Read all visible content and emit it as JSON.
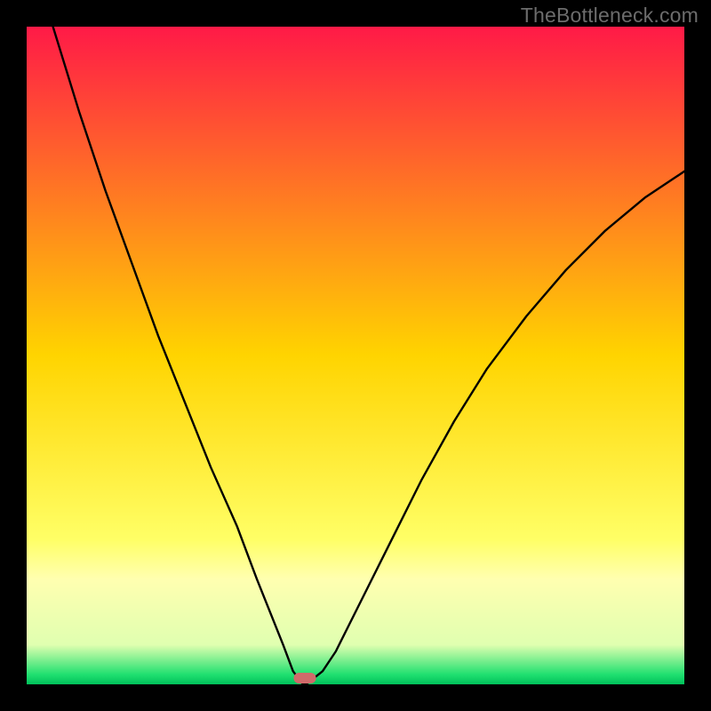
{
  "watermark": "TheBottleneck.com",
  "chart_data": {
    "type": "line",
    "title": "",
    "xlabel": "",
    "ylabel": "",
    "xlim": [
      0,
      100
    ],
    "ylim": [
      0,
      100
    ],
    "grid": false,
    "legend": false,
    "background_gradient": {
      "stops": [
        {
          "offset": 0.0,
          "color": "#ff1a47"
        },
        {
          "offset": 0.5,
          "color": "#ffd400"
        },
        {
          "offset": 0.78,
          "color": "#ffff66"
        },
        {
          "offset": 0.84,
          "color": "#ffffb0"
        },
        {
          "offset": 0.94,
          "color": "#e0ffb0"
        },
        {
          "offset": 0.985,
          "color": "#20e070"
        },
        {
          "offset": 1.0,
          "color": "#00c05a"
        }
      ]
    },
    "series": [
      {
        "name": "bottleneck-curve",
        "x": [
          4,
          8,
          12,
          16,
          20,
          24,
          28,
          32,
          35,
          37,
          39,
          40.5,
          42,
          42.5,
          45,
          47,
          49,
          52,
          56,
          60,
          65,
          70,
          76,
          82,
          88,
          94,
          100
        ],
        "y": [
          100,
          87,
          75,
          64,
          53,
          43,
          33,
          24,
          16,
          11,
          6,
          2,
          0,
          0,
          2,
          5,
          9,
          15,
          23,
          31,
          40,
          48,
          56,
          63,
          69,
          74,
          78
        ]
      }
    ],
    "marker": {
      "name": "optimal-marker",
      "center_x": 42.3,
      "width": 3.4,
      "color": "#d06a6a"
    }
  }
}
